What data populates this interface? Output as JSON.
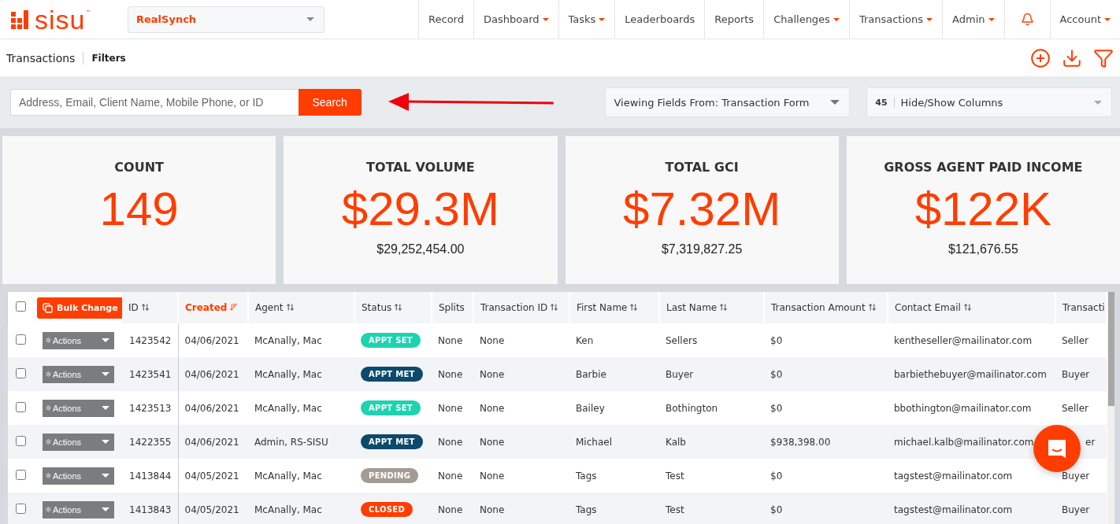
{
  "logo": {
    "text": "sisu",
    "mark": "™"
  },
  "team_select": {
    "value": "RealSynch"
  },
  "nav": [
    {
      "label": "Record",
      "caret": false
    },
    {
      "label": "Dashboard",
      "caret": true
    },
    {
      "label": "Tasks",
      "caret": true
    },
    {
      "label": "Leaderboards",
      "caret": false
    },
    {
      "label": "Reports",
      "caret": false
    },
    {
      "label": "Challenges",
      "caret": true
    },
    {
      "label": "Transactions",
      "caret": true
    },
    {
      "label": "Admin",
      "caret": true
    },
    {
      "label": "Account",
      "caret": true
    }
  ],
  "breadcrumb": {
    "title": "Transactions",
    "filters": "Filters"
  },
  "search": {
    "placeholder": "Address, Email, Client Name, Mobile Phone, or ID",
    "button": "Search"
  },
  "fields_select": {
    "value": "Viewing Fields From: Transaction Form"
  },
  "columns_select": {
    "count": "45",
    "value": "Hide/Show Columns"
  },
  "stats": [
    {
      "label": "COUNT",
      "value": "149"
    },
    {
      "label": "TOTAL VOLUME",
      "value": "$29.3M",
      "sub": "$29,252,454.00"
    },
    {
      "label": "TOTAL GCI",
      "value": "$7.32M",
      "sub": "$7,319,827.25"
    },
    {
      "label": "GROSS AGENT PAID INCOME",
      "value": "$122K",
      "sub": "$121,676.55"
    }
  ],
  "table": {
    "select_all": {
      "checked": false
    },
    "bulk_button": "Bulk Change",
    "columns": [
      {
        "label": "ID",
        "sortable": true,
        "sorted": false
      },
      {
        "label": "Created",
        "sortable": true,
        "sorted": true
      },
      {
        "label": "Agent",
        "sortable": true,
        "sorted": false
      },
      {
        "label": "Status",
        "sortable": true,
        "sorted": false
      },
      {
        "label": "Splits",
        "sortable": false,
        "sorted": false
      },
      {
        "label": "Transaction ID",
        "sortable": true,
        "sorted": false
      },
      {
        "label": "First Name",
        "sortable": true,
        "sorted": false
      },
      {
        "label": "Last Name",
        "sortable": true,
        "sorted": false
      },
      {
        "label": "Transaction Amount",
        "sortable": true,
        "sorted": false
      },
      {
        "label": "Contact Email",
        "sortable": true,
        "sorted": false
      },
      {
        "label": "Transacti",
        "sortable": false,
        "sorted": false
      }
    ],
    "rows": [
      {
        "checked": false,
        "actions": "Actions",
        "cells": [
          "1423542",
          "04/06/2021",
          "McAnally, Mac",
          {
            "status": "APPT SET",
            "color": "#1dd3b0"
          },
          "None",
          "None",
          "Ken",
          "Sellers",
          "$0",
          "kentheseller@mailinator.com",
          "Seller"
        ]
      },
      {
        "checked": false,
        "actions": "Actions",
        "cells": [
          "1423541",
          "04/06/2021",
          "McAnally, Mac",
          {
            "status": "APPT MET",
            "color": "#0b4a6b"
          },
          "None",
          "None",
          "Barbie",
          "Buyer",
          "$0",
          "barbiethebuyer@mailinator.com",
          "Buyer"
        ]
      },
      {
        "checked": false,
        "actions": "Actions",
        "cells": [
          "1423513",
          "04/06/2021",
          "McAnally, Mac",
          {
            "status": "APPT SET",
            "color": "#1dd3b0"
          },
          "None",
          "None",
          "Bailey",
          "Bothington",
          "$0",
          "bbothington@mailinator.com",
          "Seller"
        ]
      },
      {
        "checked": false,
        "actions": "Actions",
        "cells": [
          "1422355",
          "04/06/2021",
          "Admin, RS-SISU",
          {
            "status": "APPT MET",
            "color": "#0b4a6b"
          },
          "None",
          "None",
          "Michael",
          "Kalb",
          "$938,398.00",
          "michael.kalb@mailinator.com",
          {
            "text": "er",
            "clipped": true
          }
        ]
      },
      {
        "checked": false,
        "actions": "Actions",
        "cells": [
          "1413844",
          "04/05/2021",
          "McAnally, Mac",
          {
            "status": "PENDING",
            "color": "#a39c92"
          },
          "None",
          "None",
          "Tags",
          "Test",
          "$0",
          "tagstest@mailinator.com",
          "Buyer"
        ]
      },
      {
        "checked": false,
        "actions": "Actions",
        "cells": [
          "1413843",
          "04/05/2021",
          "McAnally, Mac",
          {
            "status": "CLOSED",
            "color": "#ff3d00"
          },
          "None",
          "None",
          "Tags",
          "Test",
          "$0",
          "tagstest@mailinator.com",
          "Buyer"
        ]
      }
    ]
  }
}
